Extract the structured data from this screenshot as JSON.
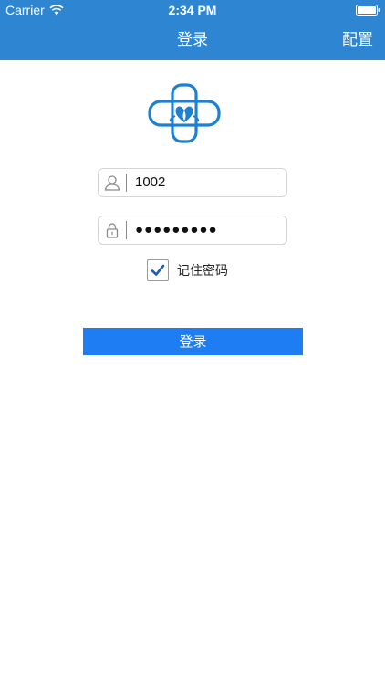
{
  "status_bar": {
    "carrier": "Carrier",
    "time": "2:34 PM",
    "wifi_icon": "wifi-icon",
    "battery_icon": "battery-icon"
  },
  "nav": {
    "title": "登录",
    "config_label": "配置",
    "background_color": "#2e86d3"
  },
  "logo": {
    "icon": "medical-cross-logo",
    "color": "#1f7fd0"
  },
  "form": {
    "username": {
      "icon": "user-icon",
      "value": "1002"
    },
    "password": {
      "icon": "lock-icon",
      "value": "●●●●●●●●●"
    },
    "remember": {
      "label": "记住密码",
      "checked": true
    },
    "submit_label": "登录",
    "submit_color": "#1e7df2"
  }
}
